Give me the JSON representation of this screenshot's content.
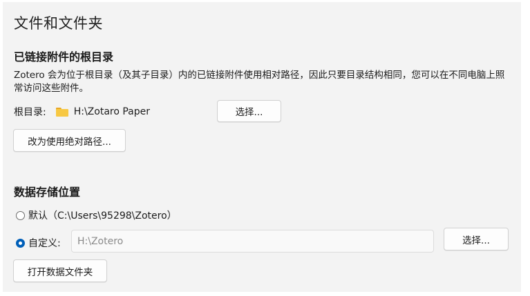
{
  "page": {
    "title": "文件和文件夹"
  },
  "linked_attachments": {
    "heading": "已链接附件的根目录",
    "description": "Zotero 会为位于根目录（及其子目录）内的已链接附件使用相对路径，因此只要目录结构相同，您可以在不同电脑上照常访问这些附件。",
    "base_dir_label": "根目录:",
    "base_dir_icon": "folder-icon",
    "base_dir_value": "H:\\Zotaro Paper",
    "choose_button": "选择...",
    "absolute_button": "改为使用绝对路径..."
  },
  "data_storage": {
    "heading": "数据存储位置",
    "default_option": "默认（C:\\Users\\95298\\Zotero）",
    "custom_option": "自定义:",
    "selected": "custom",
    "custom_path": "H:\\Zotero",
    "choose_button": "选择...",
    "open_folder_button": "打开数据文件夹"
  },
  "colors": {
    "accent": "#005fb8",
    "panel_bg": "#f3f3f3",
    "folder": "#f7c843"
  }
}
